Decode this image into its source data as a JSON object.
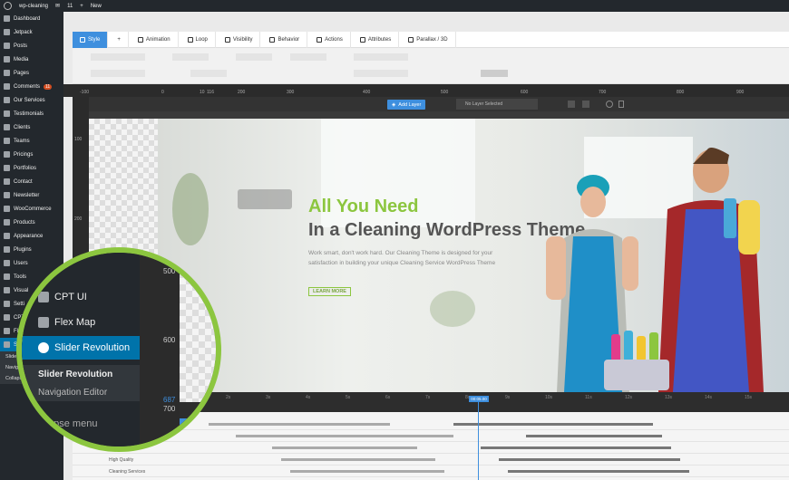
{
  "adminbar": {
    "site": "wp-cleaning",
    "comments": "11",
    "new": "New"
  },
  "sidebar": {
    "items": [
      {
        "label": "Dashboard"
      },
      {
        "label": "Jetpack"
      },
      {
        "label": "Posts"
      },
      {
        "label": "Media"
      },
      {
        "label": "Pages"
      },
      {
        "label": "Comments",
        "badge": "11"
      },
      {
        "label": "Our Services"
      },
      {
        "label": "Testimonials"
      },
      {
        "label": "Clients"
      },
      {
        "label": "Teams"
      },
      {
        "label": "Pricings"
      },
      {
        "label": "Portfolios"
      },
      {
        "label": "Contact"
      },
      {
        "label": "Newsletter"
      },
      {
        "label": "WooCommerce"
      },
      {
        "label": "Products"
      },
      {
        "label": "Appearance"
      },
      {
        "label": "Plugins"
      },
      {
        "label": "Users"
      },
      {
        "label": "Tools"
      },
      {
        "label": "Visual"
      },
      {
        "label": "Setti"
      },
      {
        "label": "CPT"
      },
      {
        "label": "Flex"
      },
      {
        "label": "Slid"
      }
    ],
    "sub1": "Slider Re",
    "sub2": "Navigation",
    "collapse": "Collapse m"
  },
  "toolbar": {
    "tabs": [
      "Style",
      "+",
      "Animation",
      "Loop",
      "Visibility",
      "Behavior",
      "Actions",
      "Attributes",
      "Parallax / 3D"
    ]
  },
  "ruler": {
    "top": [
      "-100",
      "0",
      "10",
      "116",
      "200",
      "300",
      "400",
      "500",
      "600",
      "700",
      "800",
      "900",
      "1000",
      "1100",
      "1200"
    ],
    "left": [
      "100",
      "200",
      "300"
    ]
  },
  "layerbar": {
    "add_layer": "Add Layer",
    "no_layer": "No Layer Selected"
  },
  "slide": {
    "headline1": "All You Need",
    "headline2": "In a Cleaning WordPress Theme",
    "paragraph": "Work smart, don't work hard. Our Cleaning Theme is designed for your satisfaction in building your unique Cleaning Service WordPress Theme",
    "cta": "LEARN MORE"
  },
  "timeline": {
    "ticks": [
      "1s",
      "2s",
      "3s",
      "4s",
      "5s",
      "6s",
      "7s",
      "8s",
      "9s",
      "10s",
      "11s",
      "12s",
      "13s",
      "14s",
      "15s"
    ],
    "playhead": "00:05.00",
    "rows": [
      "Image 1",
      "High Quality",
      "Cleaning Services"
    ]
  },
  "magnifier": {
    "settings": "ttings",
    "cpt_ui": "CPT UI",
    "flex_map": "Flex Map",
    "slider_revolution": "Slider Revolution",
    "sub_slider": "Slider Revolution",
    "sub_nav": "Navigation Editor",
    "collapse": "ollapse menu",
    "ruler": [
      "500",
      "600",
      "687",
      "700"
    ]
  },
  "colors": {
    "accent": "#8cc63f",
    "wp_blue": "#0073aa",
    "editor_blue": "#3e8fde"
  }
}
